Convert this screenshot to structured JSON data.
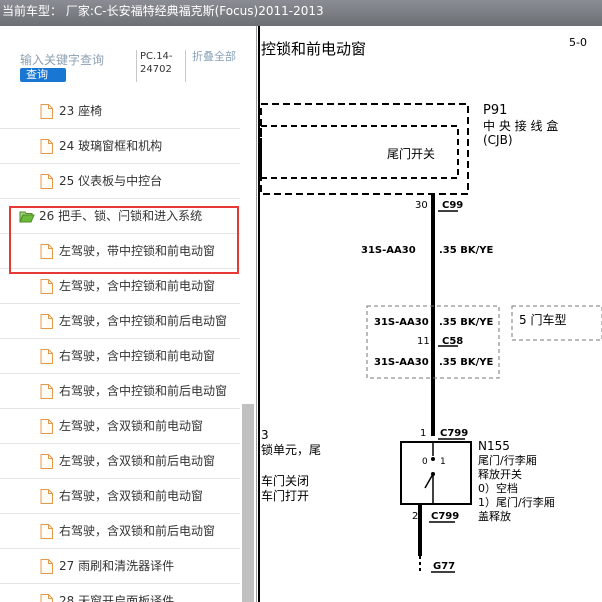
{
  "window": {
    "title": "当前车型： 厂家:C-长安福特经典福克斯(Focus)2011-2013"
  },
  "search": {
    "placeholder": "输入关键字查询",
    "button_label": "查询"
  },
  "code": {
    "line1": "PC.14-",
    "line2": "24702"
  },
  "collapse_label": "折叠全部",
  "tree": [
    {
      "label": "23 座椅",
      "type": "doc",
      "level": 1
    },
    {
      "label": "24 玻璃窗框和机构",
      "type": "doc",
      "level": 1
    },
    {
      "label": "25 仪表板与中控台",
      "type": "doc",
      "level": 1
    },
    {
      "label": "26 把手、锁、闩锁和进入系统",
      "type": "folder-open",
      "level": 0
    },
    {
      "label": "左驾驶，带中控锁和前电动窗",
      "type": "doc",
      "level": 2
    },
    {
      "label": "左驾驶，含中控锁和前电动窗",
      "type": "doc",
      "level": 2
    },
    {
      "label": "左驾驶，含中控锁和前后电动窗",
      "type": "doc",
      "level": 2
    },
    {
      "label": "右驾驶，含中控锁和前电动窗",
      "type": "doc",
      "level": 2
    },
    {
      "label": "右驾驶，含中控锁和前后电动窗",
      "type": "doc",
      "level": 2
    },
    {
      "label": "左驾驶，含双锁和前电动窗",
      "type": "doc",
      "level": 2
    },
    {
      "label": "左驾驶，含双锁和前后电动窗",
      "type": "doc",
      "level": 2
    },
    {
      "label": "右驾驶，含双锁和前电动窗",
      "type": "doc",
      "level": 2
    },
    {
      "label": "右驾驶，含双锁和前后电动窗",
      "type": "doc",
      "level": 2
    },
    {
      "label": "27 雨刷和清洗器译件",
      "type": "doc",
      "level": 1
    },
    {
      "label": "28 天窗开启面板译件",
      "type": "doc",
      "level": 1
    }
  ],
  "diagram": {
    "title": "控锁和前电动窗",
    "page_ref": "5-0",
    "cjb": {
      "name": "P91",
      "desc1": "中 央 接 线 盒",
      "desc2": "(CJB)"
    },
    "switch_label": "尾门开关",
    "pin_30": "30",
    "conn_c99": "C99",
    "wire_a_code": "31S-AA30",
    "wire_a_spec": ".35 BK/YE",
    "wire_b_code": "31S-AA30",
    "wire_b_spec": ".35 BK/YE",
    "pin_11": "11",
    "conn_c58": "C58",
    "wire_c_code": "31S-AA30",
    "wire_c_spec": ".35 BK/YE",
    "five_door": "5 门车型",
    "pin_1": "1",
    "conn_c799_top": "C799",
    "n155": {
      "name": "N155",
      "line1": "尾门/行李厢",
      "line2": "释放开关",
      "line3": "0）空档",
      "line4": "1）尾门/行李厢",
      "line5": "盖释放"
    },
    "switch_pos_0": "0",
    "switch_pos_1": "1",
    "pin_2": "2",
    "conn_c799_bottom": "C799",
    "ground": "G77",
    "left_note_num": "3",
    "left_note_1": "锁单元，尾",
    "left_note_2": "车门关闭",
    "left_note_3": "车门打开"
  },
  "colors": {
    "highlight": "#e53935",
    "button": "#1976d2",
    "folder": "#6dbb3a",
    "doc_icon": "#f0a050"
  }
}
